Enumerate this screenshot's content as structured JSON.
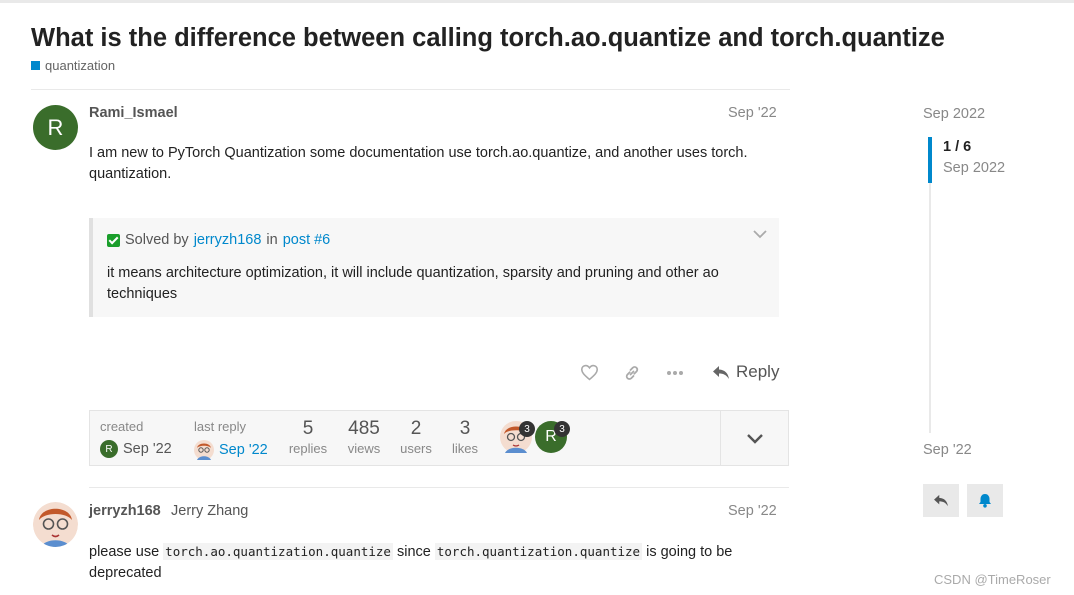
{
  "topic": {
    "title": "What is the difference between calling torch.ao.quantize and torch.quantize",
    "category": "quantization"
  },
  "post1": {
    "avatar_letter": "R",
    "username": "Rami_Ismael",
    "date": "Sep '22",
    "text_line1": "I am new to PyTorch Quantization some documentation use torch.ao.quantize, and another uses torch.",
    "text_line2": "quantization.",
    "solved": {
      "prefix": "Solved by",
      "user": "jerryzh168",
      "in": "in",
      "post": "post #6",
      "line1": "it means architecture optimization, it will include quantization, sparsity and pruning and other ao",
      "line2": "techniques"
    },
    "reply_label": "Reply"
  },
  "stats": {
    "created_label": "created",
    "created_avatar": "R",
    "created_date": "Sep '22",
    "last_reply_label": "last reply",
    "last_reply_date": "Sep '22",
    "replies": "5",
    "replies_label": "replies",
    "views": "485",
    "views_label": "views",
    "users": "2",
    "users_label": "users",
    "likes": "3",
    "likes_label": "likes",
    "participant1_count": "3",
    "participant2_letter": "R",
    "participant2_count": "3"
  },
  "post2": {
    "username": "jerryzh168",
    "fullname": "Jerry Zhang",
    "date": "Sep '22",
    "text_a": "please use",
    "code_a": "torch.ao.quantization.quantize",
    "text_b": "since",
    "code_b": "torch.quantization.quantize",
    "text_c": "is going to be",
    "text_d": "deprecated"
  },
  "timeline": {
    "top_date": "Sep 2022",
    "position": "1 / 6",
    "position_date": "Sep 2022",
    "bottom_date": "Sep '22"
  },
  "watermark": "CSDN @TimeRoser",
  "colors": {
    "accent": "#0088cc",
    "avatar_green": "#3a6d2b",
    "solved_green": "#1a9e2b"
  }
}
